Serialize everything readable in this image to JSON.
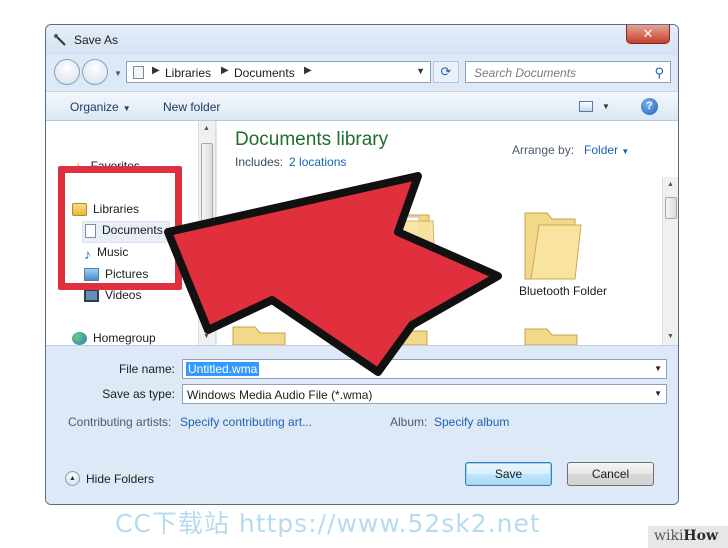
{
  "window": {
    "title": "Save As",
    "close_glyph": "✕"
  },
  "nav": {
    "breadcrumbs": [
      "Libraries",
      "Documents"
    ],
    "crumb_sep": "▶",
    "search_placeholder": "Search Documents"
  },
  "toolbar": {
    "organize_label": "Organize",
    "new_folder_label": "New folder",
    "help_glyph": "?"
  },
  "sidebar": {
    "favorites": "Favorites",
    "libraries": "Libraries",
    "items": [
      "Documents",
      "Music",
      "Pictures",
      "Videos"
    ],
    "homegroup": "Homegroup",
    "selected": "Documents"
  },
  "content": {
    "library_title": "Documents library",
    "includes_label": "Includes:",
    "includes_link": "2 locations",
    "arrange_label": "Arrange by:",
    "arrange_value": "Folder",
    "folder_label": "Bluetooth Folder"
  },
  "form": {
    "file_name_label": "File name:",
    "file_name_value": "Untitled.wma",
    "save_type_label": "Save as type:",
    "save_type_value": "Windows Media Audio File (*.wma)",
    "artists_label": "Contributing artists:",
    "artists_link": "Specify contributing art...",
    "album_label": "Album:",
    "album_link": "Specify album"
  },
  "footer": {
    "hide_folders": "Hide Folders",
    "save": "Save",
    "cancel": "Cancel"
  },
  "overlay": {
    "watermark": "CC下载站 https://www.52sk2.net",
    "brand_wiki": "wiki",
    "brand_how": "How",
    "highlight_color": "#e0303e"
  },
  "icons": {
    "favorites": "star-icon",
    "libraries": "library-icon",
    "documents": "document-icon",
    "music": "music-note-icon",
    "pictures": "picture-icon",
    "videos": "film-icon",
    "homegroup": "homegroup-icon"
  }
}
